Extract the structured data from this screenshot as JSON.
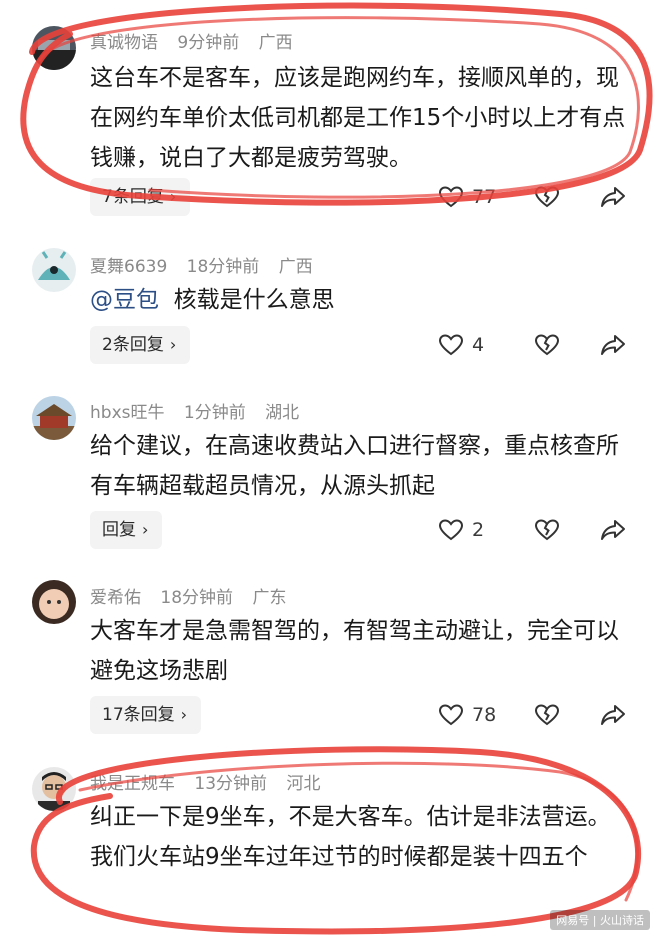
{
  "comments": [
    {
      "username": "真诚物语",
      "time": "9分钟前",
      "location": "广西",
      "text": "这台车不是客车，应该是跑网约车，接顺风单的，现在网约车单价太低司机都是工作15个小时以上才有点钱赚，说白了大都是疲劳驾驶。",
      "replies_label": "7条回复",
      "likes": "77"
    },
    {
      "username": "夏舞6639",
      "time": "18分钟前",
      "location": "广西",
      "mention": "@豆包",
      "text": "核载是什么意思",
      "replies_label": "2条回复",
      "likes": "4"
    },
    {
      "username": "hbxs旺牛",
      "time": "1分钟前",
      "location": "湖北",
      "text": "给个建议，在高速收费站入口进行督察，重点核查所有车辆超载超员情况，从源头抓起",
      "replies_label": "回复",
      "likes": "2"
    },
    {
      "username": "爱希佑",
      "time": "18分钟前",
      "location": "广东",
      "text": "大客车才是急需智驾的，有智驾主动避让，完全可以避免这场悲剧",
      "replies_label": "17条回复",
      "likes": "78"
    },
    {
      "username": "我是正规车",
      "time": "13分钟前",
      "location": "河北",
      "text": "纠正一下是9坐车，不是大客车。估计是非法营运。我们火车站9坐车过年过节的时候都是装十四五个"
    }
  ],
  "watermark": "网易号 | 火山诗话",
  "icons": {
    "like": "heart-outline-icon",
    "dislike": "broken-heart-icon",
    "share": "share-arrow-icon",
    "chevron": "chevron-right-icon"
  },
  "colors": {
    "annotation_red": "#e8413a",
    "mention_blue": "#2c4f86",
    "meta_gray": "#8a8a8a"
  }
}
